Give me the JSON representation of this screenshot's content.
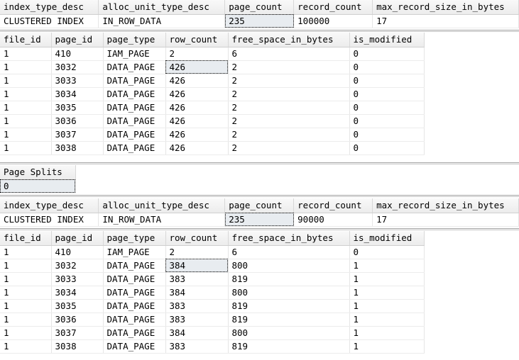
{
  "results": [
    {
      "columns": [
        "index_type_desc",
        "alloc_unit_type_desc",
        "page_count",
        "record_count",
        "max_record_size_in_bytes"
      ],
      "rows": [
        [
          "CLUSTERED INDEX",
          "IN_ROW_DATA",
          "235",
          "100000",
          "17"
        ]
      ]
    },
    {
      "columns": [
        "file_id",
        "page_id",
        "page_type",
        "row_count",
        "free_space_in_bytes",
        "is_modified"
      ],
      "rows": [
        [
          "1",
          "410",
          "IAM_PAGE",
          "2",
          "6",
          "0"
        ],
        [
          "1",
          "3032",
          "DATA_PAGE",
          "426",
          "2",
          "0"
        ],
        [
          "1",
          "3033",
          "DATA_PAGE",
          "426",
          "2",
          "0"
        ],
        [
          "1",
          "3034",
          "DATA_PAGE",
          "426",
          "2",
          "0"
        ],
        [
          "1",
          "3035",
          "DATA_PAGE",
          "426",
          "2",
          "0"
        ],
        [
          "1",
          "3036",
          "DATA_PAGE",
          "426",
          "2",
          "0"
        ],
        [
          "1",
          "3037",
          "DATA_PAGE",
          "426",
          "2",
          "0"
        ],
        [
          "1",
          "3038",
          "DATA_PAGE",
          "426",
          "2",
          "0"
        ]
      ]
    },
    {
      "columns": [
        "Page Splits"
      ],
      "rows": [
        [
          "0"
        ]
      ]
    },
    {
      "columns": [
        "index_type_desc",
        "alloc_unit_type_desc",
        "page_count",
        "record_count",
        "max_record_size_in_bytes"
      ],
      "rows": [
        [
          "CLUSTERED INDEX",
          "IN_ROW_DATA",
          "235",
          "90000",
          "17"
        ]
      ]
    },
    {
      "columns": [
        "file_id",
        "page_id",
        "page_type",
        "row_count",
        "free_space_in_bytes",
        "is_modified"
      ],
      "rows": [
        [
          "1",
          "410",
          "IAM_PAGE",
          "2",
          "6",
          "0"
        ],
        [
          "1",
          "3032",
          "DATA_PAGE",
          "384",
          "800",
          "1"
        ],
        [
          "1",
          "3033",
          "DATA_PAGE",
          "383",
          "819",
          "1"
        ],
        [
          "1",
          "3034",
          "DATA_PAGE",
          "384",
          "800",
          "1"
        ],
        [
          "1",
          "3035",
          "DATA_PAGE",
          "383",
          "819",
          "1"
        ],
        [
          "1",
          "3036",
          "DATA_PAGE",
          "383",
          "819",
          "1"
        ],
        [
          "1",
          "3037",
          "DATA_PAGE",
          "384",
          "800",
          "1"
        ],
        [
          "1",
          "3038",
          "DATA_PAGE",
          "383",
          "819",
          "1"
        ]
      ]
    }
  ]
}
